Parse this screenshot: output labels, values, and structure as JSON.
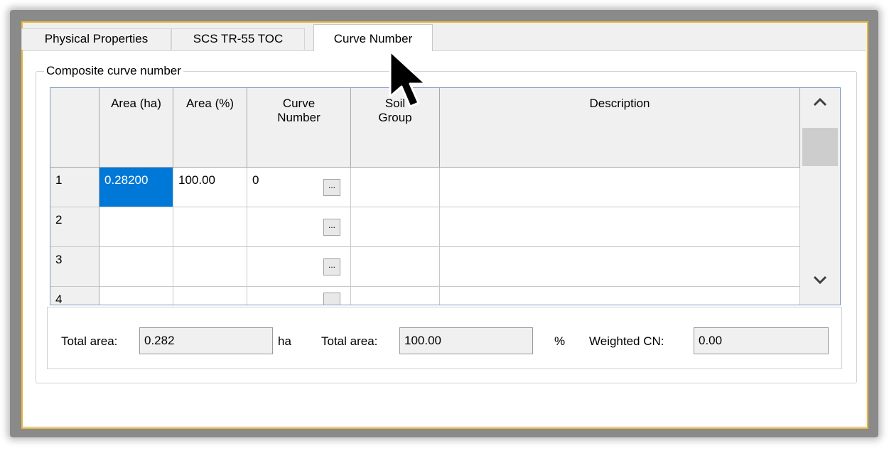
{
  "tabs": [
    {
      "label": "Physical Properties"
    },
    {
      "label": "SCS TR-55 TOC"
    },
    {
      "label": "Curve Number"
    }
  ],
  "group_title": "Composite curve number",
  "table": {
    "headers": [
      {
        "label": "Area (ha)"
      },
      {
        "label": "Area (%)"
      },
      {
        "line1": "Curve",
        "line2": "Number"
      },
      {
        "line1": "Soil",
        "line2": "Group"
      },
      {
        "label": "Description"
      }
    ],
    "rows": [
      {
        "num": "1",
        "area_ha": "0.28200",
        "area_pct": "100.00",
        "cn": "0",
        "btn": "...",
        "soil": "",
        "desc": ""
      },
      {
        "num": "2",
        "area_ha": "",
        "area_pct": "",
        "cn": "",
        "btn": "...",
        "soil": "",
        "desc": ""
      },
      {
        "num": "3",
        "area_ha": "",
        "area_pct": "",
        "cn": "",
        "btn": "...",
        "soil": "",
        "desc": ""
      },
      {
        "num": "4",
        "area_ha": "",
        "area_pct": "",
        "cn": "",
        "btn": "",
        "soil": "",
        "desc": ""
      }
    ]
  },
  "totals": {
    "area_label": "Total area:",
    "area_value": "0.282",
    "area_unit": "ha",
    "pct_label": "Total area:",
    "pct_value": "100.00",
    "pct_unit": "%",
    "cn_label": "Weighted CN:",
    "cn_value": "0.00"
  },
  "colors": {
    "selection": "#0078d7",
    "window_border": "#e5b83a"
  }
}
